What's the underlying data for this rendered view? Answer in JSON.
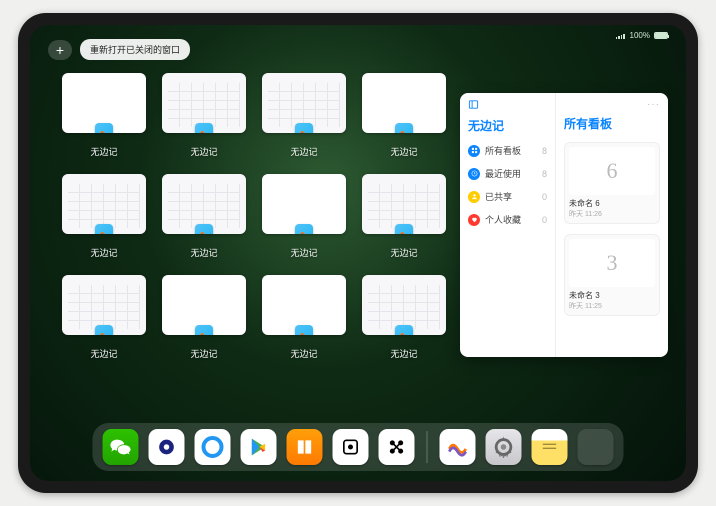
{
  "status": {
    "battery_pct": "100%"
  },
  "topbar": {
    "add_label": "+",
    "restore_label": "重新打开已关闭的窗口"
  },
  "app_name": "无边记",
  "windows": [
    {
      "label": "无边记",
      "variant": "blank"
    },
    {
      "label": "无边记",
      "variant": "calendar"
    },
    {
      "label": "无边记",
      "variant": "calendar"
    },
    {
      "label": "无边记",
      "variant": "blank"
    },
    {
      "label": "无边记",
      "variant": "calendar"
    },
    {
      "label": "无边记",
      "variant": "calendar"
    },
    {
      "label": "无边记",
      "variant": "blank"
    },
    {
      "label": "无边记",
      "variant": "calendar"
    },
    {
      "label": "无边记",
      "variant": "calendar"
    },
    {
      "label": "无边记",
      "variant": "blank"
    },
    {
      "label": "无边记",
      "variant": "blank"
    },
    {
      "label": "无边记",
      "variant": "calendar"
    }
  ],
  "sidebar": {
    "left_title": "无边记",
    "items": [
      {
        "label": "所有看板",
        "count": "8",
        "color": "#0a84ff",
        "icon": "grid"
      },
      {
        "label": "最近使用",
        "count": "8",
        "color": "#0a84ff",
        "icon": "clock"
      },
      {
        "label": "已共享",
        "count": "0",
        "color": "#ffcc00",
        "icon": "person"
      },
      {
        "label": "个人收藏",
        "count": "0",
        "color": "#ff3b30",
        "icon": "heart"
      }
    ],
    "right_title": "所有看板",
    "more": "···",
    "boards": [
      {
        "glyph": "6",
        "title": "未命名 6",
        "sub": "昨天 11:26"
      },
      {
        "glyph": "3",
        "title": "未命名 3",
        "sub": "昨天 11:25"
      }
    ]
  },
  "dock": {
    "items": [
      {
        "name": "wechat",
        "bg": "linear-gradient(#2dc100,#22a400)"
      },
      {
        "name": "quark",
        "bg": "#fff"
      },
      {
        "name": "qqbrowser",
        "bg": "#fff"
      },
      {
        "name": "play",
        "bg": "#fff"
      },
      {
        "name": "books",
        "bg": "linear-gradient(#ff9f0a,#ff7a00)"
      },
      {
        "name": "dice",
        "bg": "#fff"
      },
      {
        "name": "obs",
        "bg": "#fff"
      },
      {
        "name": "freeform",
        "bg": "#fff"
      },
      {
        "name": "settings",
        "bg": "linear-gradient(#e5e5ea,#c7c7cc)"
      },
      {
        "name": "notes",
        "bg": "linear-gradient(#fff 0 32%,#ffe066 32% 100%)"
      }
    ]
  }
}
